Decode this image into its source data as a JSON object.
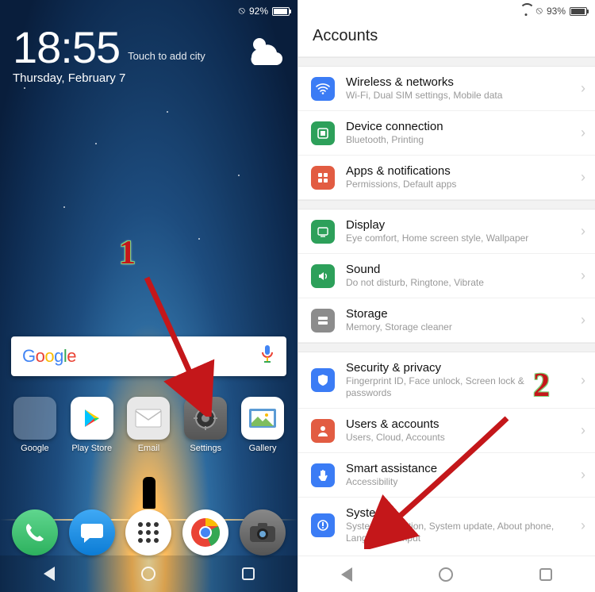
{
  "homescreen": {
    "status": {
      "battery": "92%"
    },
    "time": "18:55",
    "add_city": "Touch to add city",
    "date": "Thursday, February 7",
    "apps": {
      "google": "Google",
      "playstore": "Play Store",
      "email": "Email",
      "settings": "Settings",
      "gallery": "Gallery"
    }
  },
  "settings": {
    "status": {
      "battery": "93%"
    },
    "title": "Accounts",
    "groups": [
      [
        {
          "icon": "wifi",
          "color": "#3B7CF5",
          "title": "Wireless & networks",
          "sub": "Wi-Fi, Dual SIM settings, Mobile data"
        },
        {
          "icon": "device",
          "color": "#2DA05A",
          "title": "Device connection",
          "sub": "Bluetooth, Printing"
        },
        {
          "icon": "apps",
          "color": "#E25C42",
          "title": "Apps & notifications",
          "sub": "Permissions, Default apps"
        }
      ],
      [
        {
          "icon": "display",
          "color": "#2DA05A",
          "title": "Display",
          "sub": "Eye comfort, Home screen style, Wallpaper"
        },
        {
          "icon": "sound",
          "color": "#2DA05A",
          "title": "Sound",
          "sub": "Do not disturb, Ringtone, Vibrate"
        },
        {
          "icon": "storage",
          "color": "#8C8C8C",
          "title": "Storage",
          "sub": "Memory, Storage cleaner"
        }
      ],
      [
        {
          "icon": "security",
          "color": "#3B7CF5",
          "title": "Security & privacy",
          "sub": "Fingerprint ID, Face unlock, Screen lock & passwords"
        },
        {
          "icon": "users",
          "color": "#E25C42",
          "title": "Users & accounts",
          "sub": "Users, Cloud, Accounts"
        },
        {
          "icon": "smart",
          "color": "#3B7CF5",
          "title": "Smart assistance",
          "sub": "Accessibility"
        },
        {
          "icon": "system",
          "color": "#3B7CF5",
          "title": "System",
          "sub": "System navigation, System update, About phone, Language & input"
        }
      ]
    ]
  },
  "annotations": {
    "one": "1",
    "two": "2"
  }
}
